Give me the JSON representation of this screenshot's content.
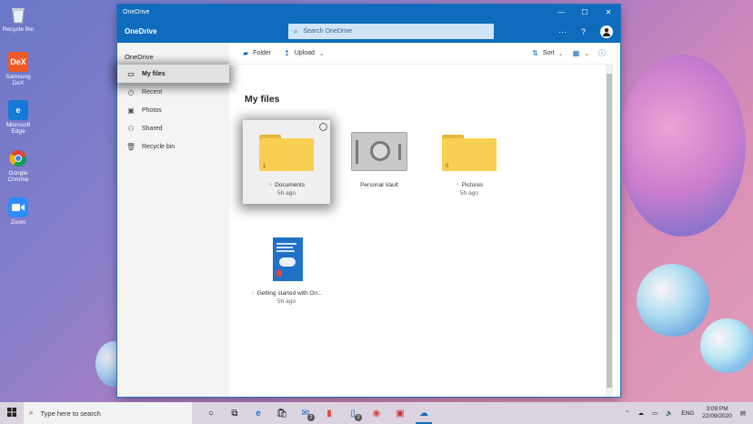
{
  "desktop": {
    "icons": [
      {
        "label": "Recycle Bin",
        "icon": "recycle-bin-icon"
      },
      {
        "label": "Samsung DeX",
        "icon": "dex-icon",
        "badge": "DeX"
      },
      {
        "label": "Microsoft Edge",
        "icon": "edge-icon",
        "badge": "e"
      },
      {
        "label": "Google Chrome",
        "icon": "chrome-icon"
      },
      {
        "label": "Zoom",
        "icon": "zoom-icon"
      }
    ]
  },
  "window": {
    "title": "OneDrive",
    "controls": {
      "minimize": "—",
      "maximize": "☐",
      "close": "✕"
    }
  },
  "appbar": {
    "brand": "OneDrive",
    "search_placeholder": "Search OneDrive",
    "more": "···",
    "help": "?"
  },
  "sidebar": {
    "heading": "OneDrive",
    "items": [
      {
        "label": "My files",
        "active": true
      },
      {
        "label": "Recent"
      },
      {
        "label": "Photos"
      },
      {
        "label": "Shared"
      },
      {
        "label": "Recycle bin"
      }
    ]
  },
  "toolbar": {
    "folder": "Folder",
    "upload": "Upload",
    "sort": "Sort"
  },
  "main": {
    "title": "My files",
    "tiles": [
      {
        "name": "Documents",
        "modified": "5h ago",
        "count": "1",
        "selected": true
      },
      {
        "name": "Personal Vault"
      },
      {
        "name": "Pictures",
        "modified": "5h ago",
        "count": "0"
      },
      {
        "name": "Getting started with On...",
        "modified": "5h ago"
      }
    ]
  },
  "taskbar": {
    "search_placeholder": "Type here to search",
    "mail_badge": "2",
    "store_badge": "3",
    "language": "ENG",
    "time": "3:09 PM",
    "date": "22/09/2020"
  }
}
